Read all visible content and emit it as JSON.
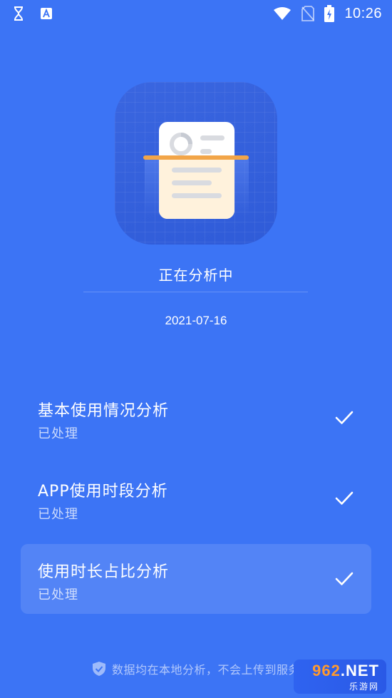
{
  "status_bar": {
    "time": "10:26",
    "left_icons": [
      "hourglass-icon",
      "translate-icon"
    ],
    "right_icons": [
      "wifi-icon",
      "no-sim-icon",
      "battery-charging-icon"
    ]
  },
  "hero": {
    "icon": "document-scan-icon"
  },
  "analysis": {
    "status_label": "正在分析中",
    "date": "2021-07-16"
  },
  "tasks": [
    {
      "title": "基本使用情况分析",
      "status": "已处理",
      "icon": "check-icon"
    },
    {
      "title": "APP使用时段分析",
      "status": "已处理",
      "icon": "check-icon"
    },
    {
      "title": "使用时长占比分析",
      "status": "已处理",
      "icon": "check-icon"
    }
  ],
  "footer": {
    "icon": "shield-check-icon",
    "note": "数据均在本地分析，不会上传到服务"
  },
  "watermark": {
    "logo_number": "962",
    "logo_suffix": ".NET",
    "sub": "乐游网"
  },
  "colors": {
    "background": "#3c74f5",
    "scan_bar": "#f2a548",
    "text": "#ffffff"
  }
}
